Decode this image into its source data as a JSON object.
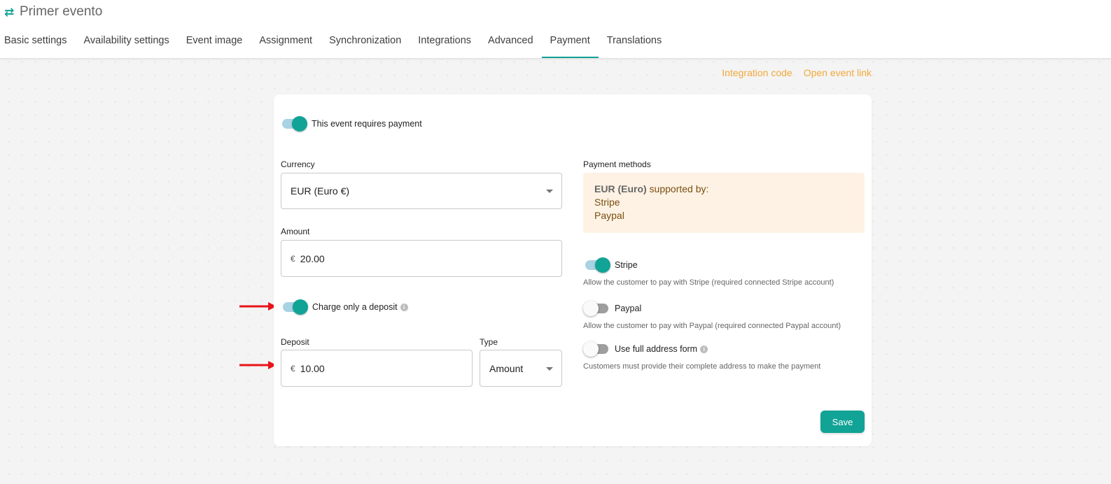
{
  "header": {
    "icon": "swap-arrows-icon",
    "title": "Primer evento",
    "tabs": [
      {
        "label": "Basic settings",
        "active": false
      },
      {
        "label": "Availability settings",
        "active": false
      },
      {
        "label": "Event image",
        "active": false
      },
      {
        "label": "Assignment",
        "active": false
      },
      {
        "label": "Synchronization",
        "active": false
      },
      {
        "label": "Integrations",
        "active": false
      },
      {
        "label": "Advanced",
        "active": false
      },
      {
        "label": "Payment",
        "active": true
      },
      {
        "label": "Translations",
        "active": false
      }
    ]
  },
  "links": {
    "integration_code": "Integration code",
    "open_event_link": "Open event link"
  },
  "form": {
    "requires_payment": {
      "label": "This event requires payment",
      "checked": true
    },
    "currency": {
      "label": "Currency",
      "value": "EUR (Euro €)"
    },
    "amount": {
      "label": "Amount",
      "prefix": "€",
      "value": "20.00"
    },
    "deposit_toggle": {
      "label": "Charge only a deposit",
      "checked": true
    },
    "deposit": {
      "label": "Deposit",
      "prefix": "€",
      "value": "10.00"
    },
    "type": {
      "label": "Type",
      "value": "Amount"
    },
    "payment_methods": {
      "label": "Payment methods",
      "currency_bold": "EUR (Euro)",
      "supported_by": " supported by:",
      "providers": [
        "Stripe",
        "Paypal"
      ]
    },
    "stripe": {
      "label": "Stripe",
      "checked": true,
      "hint": "Allow the customer to pay with Stripe (required connected Stripe account)"
    },
    "paypal": {
      "label": "Paypal",
      "checked": false,
      "hint": "Allow the customer to pay with Paypal (required connected Paypal account)"
    },
    "full_address": {
      "label": "Use full address form",
      "checked": false,
      "hint": "Customers must provide their complete address to make the payment"
    },
    "save_label": "Save"
  },
  "colors": {
    "accent": "#11a396",
    "link": "#f2a93b",
    "annotation_arrow": "#e8141a"
  }
}
